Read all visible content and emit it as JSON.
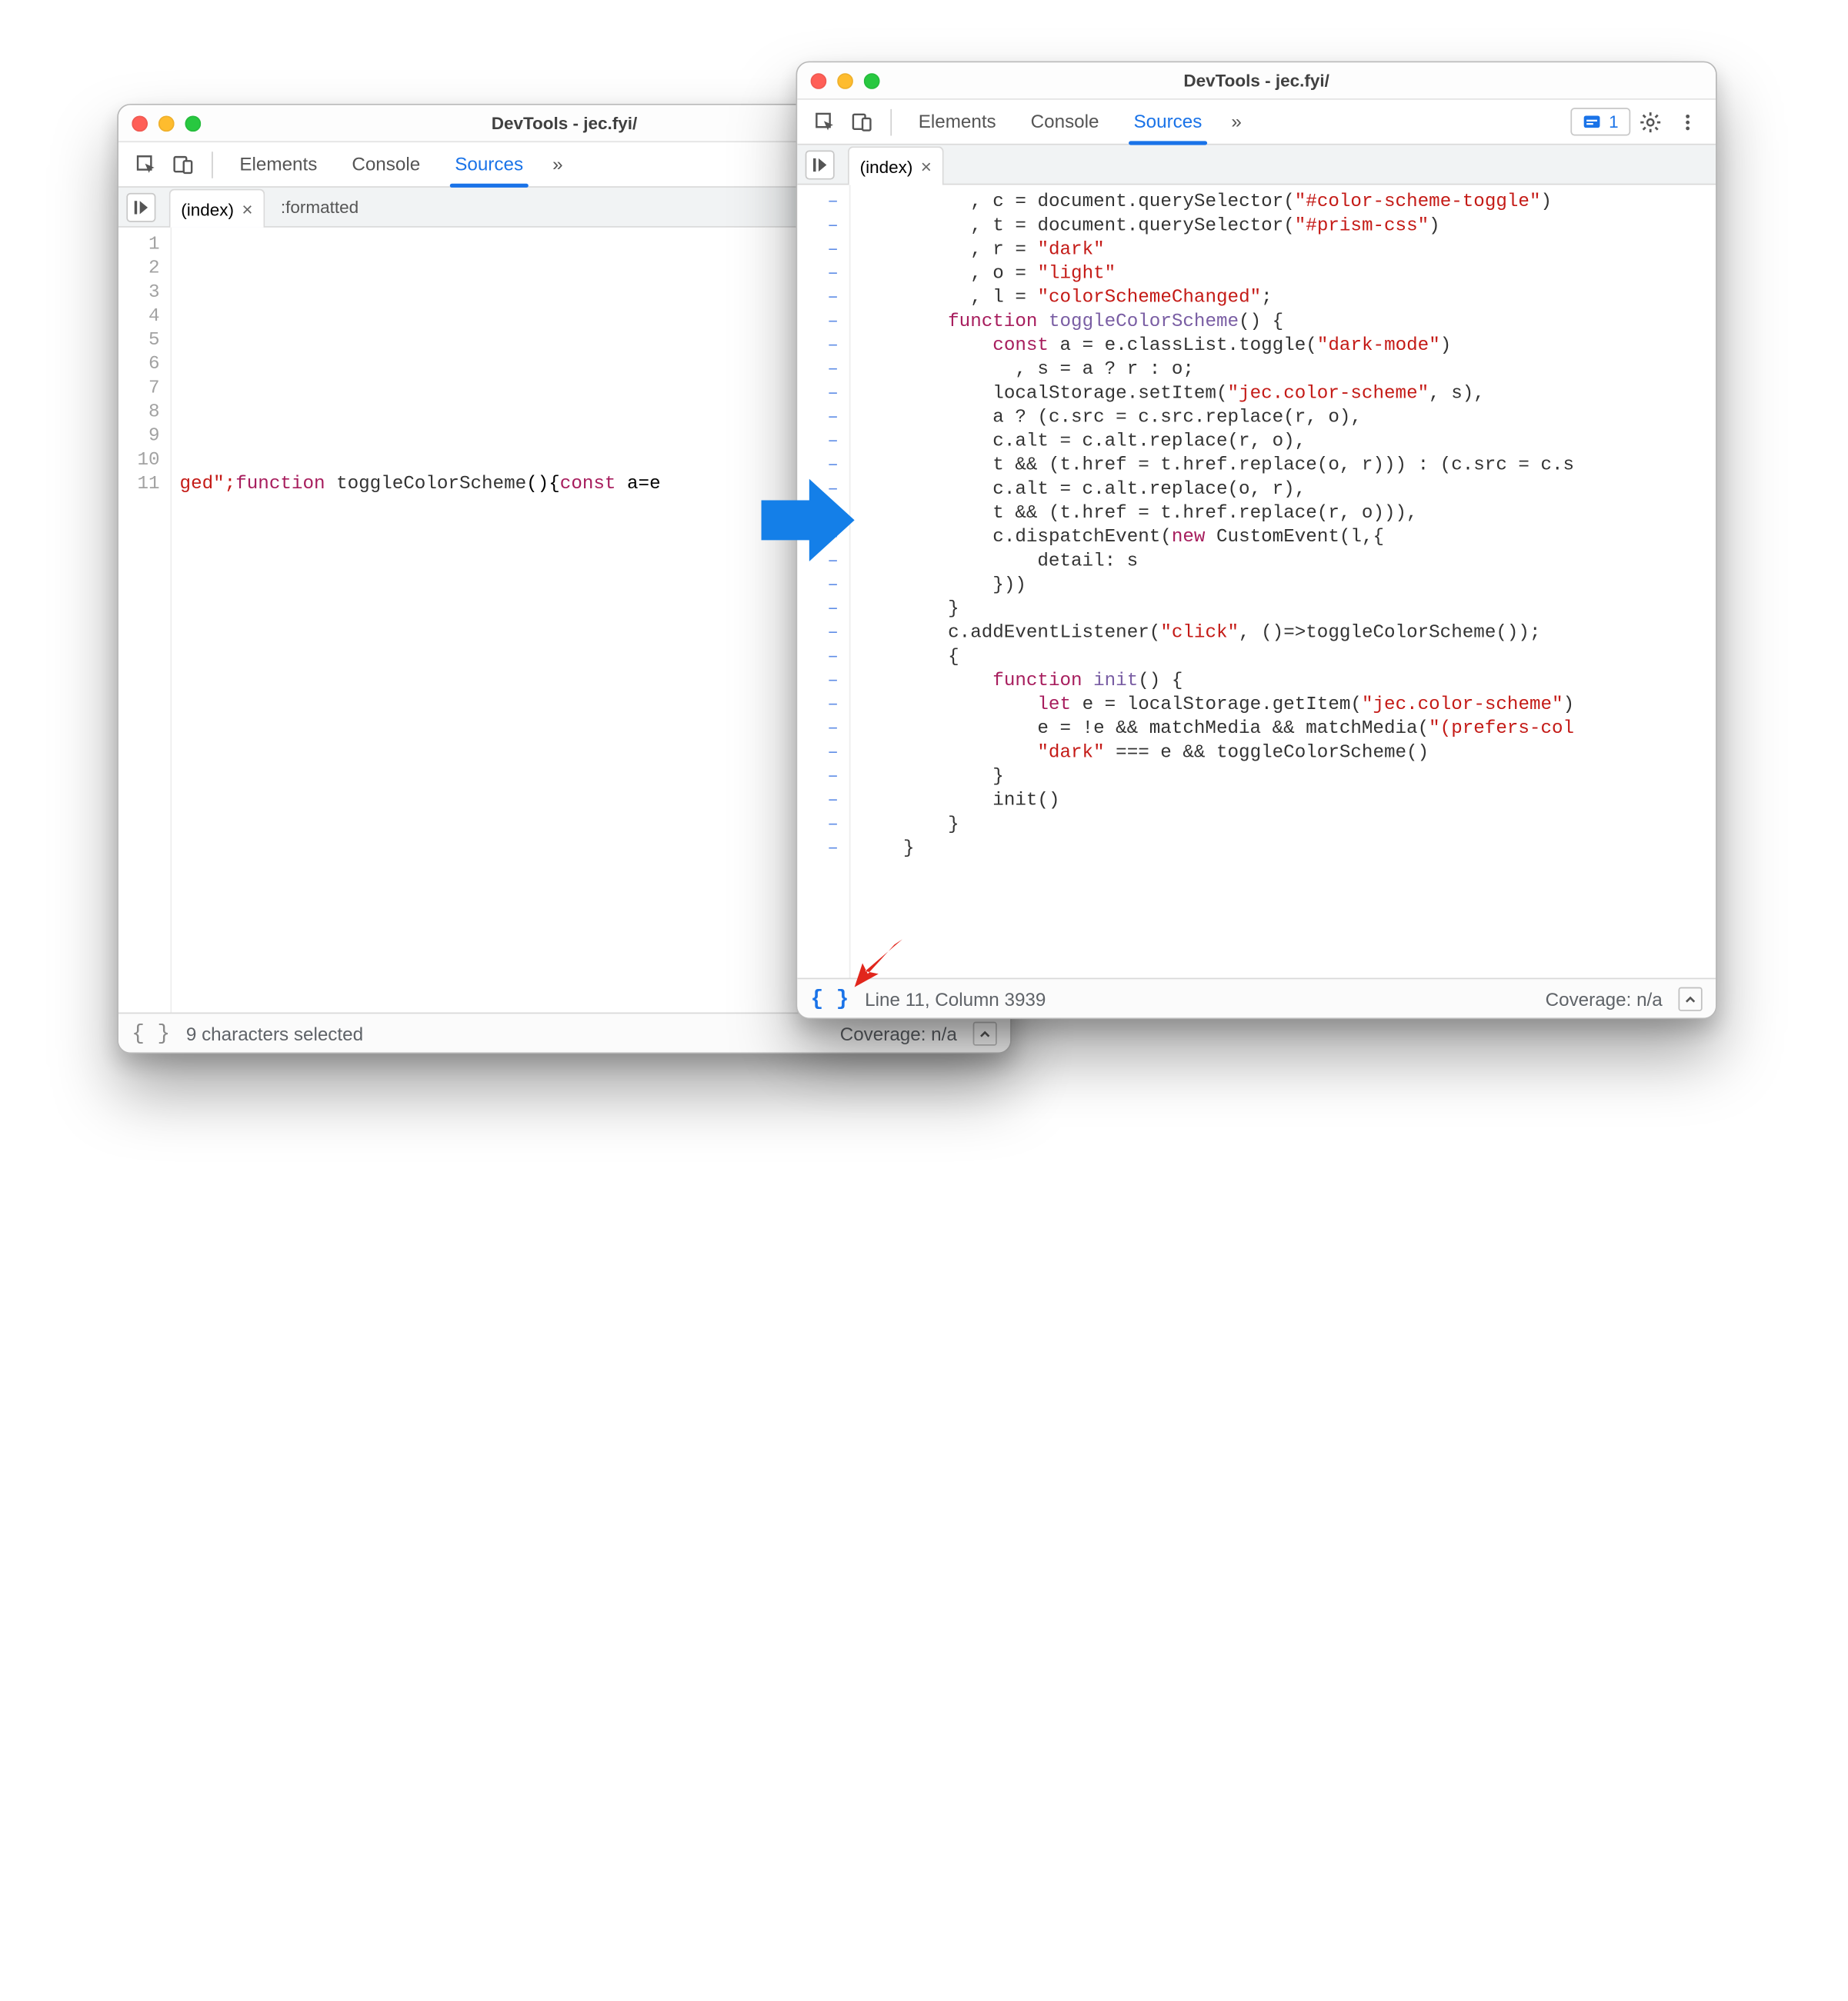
{
  "left": {
    "title": "DevTools - jec.fyi/",
    "tabs": {
      "elements": "Elements",
      "console": "Console",
      "sources": "Sources"
    },
    "more_tabs_glyph": "»",
    "file_tab": "(index)",
    "formatted_crumb": ":formatted",
    "gutter": [
      "1",
      "2",
      "3",
      "4",
      "5",
      "6",
      "7",
      "8",
      "9",
      "10",
      "11"
    ],
    "code_line11": {
      "pre": "ged\";",
      "kw1": "function",
      "space1": " ",
      "fname": "toggleColorScheme",
      "paren": "(){",
      "kw2": "const",
      "space2": " a=e"
    },
    "status": {
      "text": "9 characters selected",
      "coverage": "Coverage: n/a"
    }
  },
  "right": {
    "title": "DevTools - jec.fyi/",
    "tabs": {
      "elements": "Elements",
      "console": "Console",
      "sources": "Sources"
    },
    "more_tabs_glyph": "»",
    "issues_count": "1",
    "file_tab": "(index)",
    "gutter_dash": "–",
    "gutter_rows": 28,
    "code": [
      [
        [
          "punc",
          "          , "
        ],
        [
          "ident",
          "c"
        ],
        [
          "punc",
          " = "
        ],
        [
          "ident",
          "document.querySelector("
        ],
        [
          "str",
          "\"#color-scheme-toggle\""
        ],
        [
          "punc",
          ")"
        ]
      ],
      [
        [
          "punc",
          "          , "
        ],
        [
          "ident",
          "t"
        ],
        [
          "punc",
          " = "
        ],
        [
          "ident",
          "document.querySelector("
        ],
        [
          "str",
          "\"#prism-css\""
        ],
        [
          "punc",
          ")"
        ]
      ],
      [
        [
          "punc",
          "          , "
        ],
        [
          "ident",
          "r"
        ],
        [
          "punc",
          " = "
        ],
        [
          "str",
          "\"dark\""
        ]
      ],
      [
        [
          "punc",
          "          , "
        ],
        [
          "ident",
          "o"
        ],
        [
          "punc",
          " = "
        ],
        [
          "str",
          "\"light\""
        ]
      ],
      [
        [
          "punc",
          "          , "
        ],
        [
          "ident",
          "l"
        ],
        [
          "punc",
          " = "
        ],
        [
          "str",
          "\"colorSchemeChanged\""
        ],
        [
          "punc",
          ";"
        ]
      ],
      [
        [
          "punc",
          "        "
        ],
        [
          "kw",
          "function"
        ],
        [
          "punc",
          " "
        ],
        [
          "fn",
          "toggleColorScheme"
        ],
        [
          "punc",
          "() {"
        ]
      ],
      [
        [
          "punc",
          "            "
        ],
        [
          "kw",
          "const"
        ],
        [
          "punc",
          " "
        ],
        [
          "ident",
          "a"
        ],
        [
          "punc",
          " = "
        ],
        [
          "ident",
          "e.classList.toggle("
        ],
        [
          "str",
          "\"dark-mode\""
        ],
        [
          "punc",
          ")"
        ]
      ],
      [
        [
          "punc",
          "              , "
        ],
        [
          "ident",
          "s"
        ],
        [
          "punc",
          " = "
        ],
        [
          "ident",
          "a ? r : o;"
        ]
      ],
      [
        [
          "punc",
          "            "
        ],
        [
          "ident",
          "localStorage.setItem("
        ],
        [
          "str",
          "\"jec.color-scheme\""
        ],
        [
          "punc",
          ", s),"
        ]
      ],
      [
        [
          "punc",
          "            "
        ],
        [
          "ident",
          "a ? (c.src = c.src.replace(r, o),"
        ]
      ],
      [
        [
          "punc",
          "            "
        ],
        [
          "ident",
          "c.alt = c.alt.replace(r, o),"
        ]
      ],
      [
        [
          "punc",
          "            "
        ],
        [
          "ident",
          "t && (t.href = t.href.replace(o, r))) : (c.src = c.s"
        ]
      ],
      [
        [
          "punc",
          "            "
        ],
        [
          "ident",
          "c.alt = c.alt.replace(o, r),"
        ]
      ],
      [
        [
          "punc",
          "            "
        ],
        [
          "ident",
          "t && (t.href = t.href.replace(r, o))),"
        ]
      ],
      [
        [
          "punc",
          "            "
        ],
        [
          "ident",
          "c.dispatchEvent("
        ],
        [
          "kw",
          "new"
        ],
        [
          "punc",
          " "
        ],
        [
          "ident",
          "CustomEvent(l,{"
        ]
      ],
      [
        [
          "punc",
          "                "
        ],
        [
          "ident",
          "detail: s"
        ]
      ],
      [
        [
          "punc",
          "            "
        ],
        [
          "ident",
          "}))"
        ]
      ],
      [
        [
          "punc",
          "        }"
        ]
      ],
      [
        [
          "punc",
          "        "
        ],
        [
          "ident",
          "c.addEventListener("
        ],
        [
          "str",
          "\"click\""
        ],
        [
          "punc",
          ", ()=>toggleColorScheme());"
        ]
      ],
      [
        [
          "punc",
          "        {"
        ]
      ],
      [
        [
          "punc",
          "            "
        ],
        [
          "kw",
          "function"
        ],
        [
          "punc",
          " "
        ],
        [
          "fn",
          "init"
        ],
        [
          "punc",
          "() {"
        ]
      ],
      [
        [
          "punc",
          "                "
        ],
        [
          "kw",
          "let"
        ],
        [
          "punc",
          " "
        ],
        [
          "ident",
          "e"
        ],
        [
          "punc",
          " = "
        ],
        [
          "ident",
          "localStorage.getItem("
        ],
        [
          "str",
          "\"jec.color-scheme\""
        ],
        [
          "punc",
          ")"
        ]
      ],
      [
        [
          "punc",
          "                "
        ],
        [
          "ident",
          "e = !e && matchMedia && matchMedia("
        ],
        [
          "str",
          "\"(prefers-col"
        ]
      ],
      [
        [
          "punc",
          "                "
        ],
        [
          "str",
          "\"dark\""
        ],
        [
          "punc",
          " === e && toggleColorScheme()"
        ]
      ],
      [
        [
          "punc",
          "            }"
        ]
      ],
      [
        [
          "punc",
          "            "
        ],
        [
          "ident",
          "init()"
        ]
      ],
      [
        [
          "punc",
          "        }"
        ]
      ],
      [
        [
          "punc",
          "    }"
        ]
      ]
    ],
    "status": {
      "cursor": "Line 11, Column 3939",
      "coverage": "Coverage: n/a"
    }
  }
}
